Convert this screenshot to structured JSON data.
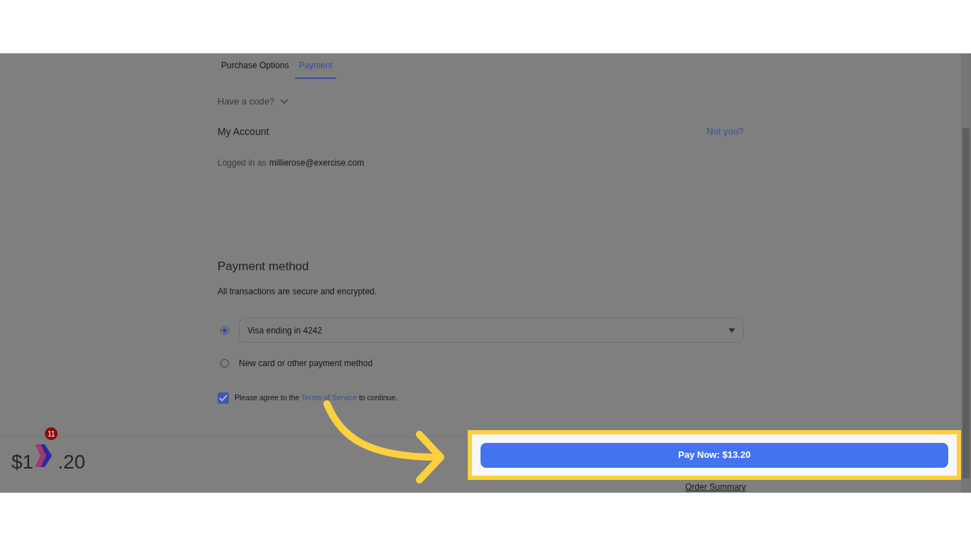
{
  "tabs": [
    {
      "label": "Purchase Options",
      "selected": false
    },
    {
      "label": "Payment",
      "selected": true
    }
  ],
  "code_toggle": {
    "label": "Have a code?",
    "expanded": false
  },
  "account": {
    "title": "My Account",
    "link": "Not you?",
    "logged_in_label": "Logged in as",
    "email": "millierose@exercise.com"
  },
  "payment": {
    "title": "Payment method",
    "subtitle": "All transactions are secure and encrypted.",
    "options": [
      {
        "kind": "select",
        "selected": true,
        "value": "Visa ending in 4242"
      },
      {
        "kind": "label",
        "selected": false,
        "label": "New card or other payment method"
      }
    ]
  },
  "terms": {
    "checked": true,
    "before": "Please agree to the",
    "link": "Terms of Service",
    "after": "to continue."
  },
  "footer": {
    "total_parts": [
      "$1",
      ".20"
    ],
    "pay_button": "Pay Now: $13.20",
    "summary_link": "Order Summary"
  },
  "floating_app": {
    "badge": "11"
  }
}
